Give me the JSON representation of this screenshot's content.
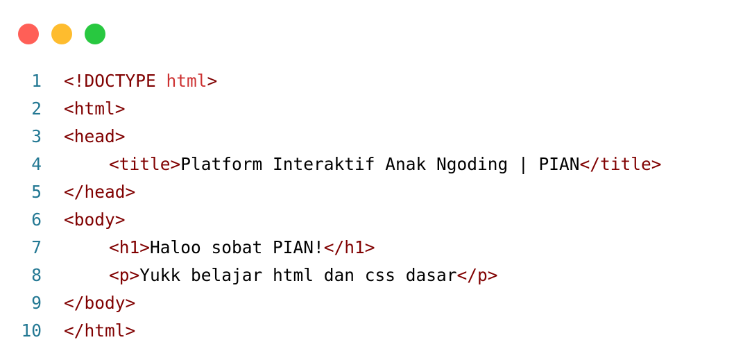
{
  "window_controls": {
    "close_color": "#ff5f57",
    "minimize_color": "#febc2e",
    "maximize_color": "#28c840"
  },
  "colors": {
    "line_number": "#237893",
    "tag": "#800000",
    "keyword": "#cd3131",
    "text": "#000000"
  },
  "lines": [
    {
      "number": "1",
      "indent": false,
      "tokens": [
        {
          "kind": "tag",
          "text": "<!DOCTYPE "
        },
        {
          "kind": "kw",
          "text": "html"
        },
        {
          "kind": "tag",
          "text": ">"
        }
      ]
    },
    {
      "number": "2",
      "indent": false,
      "tokens": [
        {
          "kind": "tag",
          "text": "<html>"
        }
      ]
    },
    {
      "number": "3",
      "indent": false,
      "tokens": [
        {
          "kind": "tag",
          "text": "<head>"
        }
      ]
    },
    {
      "number": "4",
      "indent": true,
      "tokens": [
        {
          "kind": "tag",
          "text": "<title>"
        },
        {
          "kind": "text",
          "text": "Platform Interaktif Anak Ngoding | PIAN"
        },
        {
          "kind": "tag",
          "text": "</title>"
        }
      ]
    },
    {
      "number": "5",
      "indent": false,
      "tokens": [
        {
          "kind": "tag",
          "text": "</head>"
        }
      ]
    },
    {
      "number": "6",
      "indent": false,
      "tokens": [
        {
          "kind": "tag",
          "text": "<body>"
        }
      ]
    },
    {
      "number": "7",
      "indent": true,
      "tokens": [
        {
          "kind": "tag",
          "text": "<h1>"
        },
        {
          "kind": "text",
          "text": "Haloo sobat PIAN!"
        },
        {
          "kind": "tag",
          "text": "</h1>"
        }
      ]
    },
    {
      "number": "8",
      "indent": true,
      "tokens": [
        {
          "kind": "tag",
          "text": "<p>"
        },
        {
          "kind": "text",
          "text": "Yukk belajar html dan css dasar"
        },
        {
          "kind": "tag",
          "text": "</p>"
        }
      ]
    },
    {
      "number": "9",
      "indent": false,
      "tokens": [
        {
          "kind": "tag",
          "text": "</body>"
        }
      ]
    },
    {
      "number": "10",
      "indent": false,
      "tokens": [
        {
          "kind": "tag",
          "text": "</html>"
        }
      ]
    }
  ]
}
